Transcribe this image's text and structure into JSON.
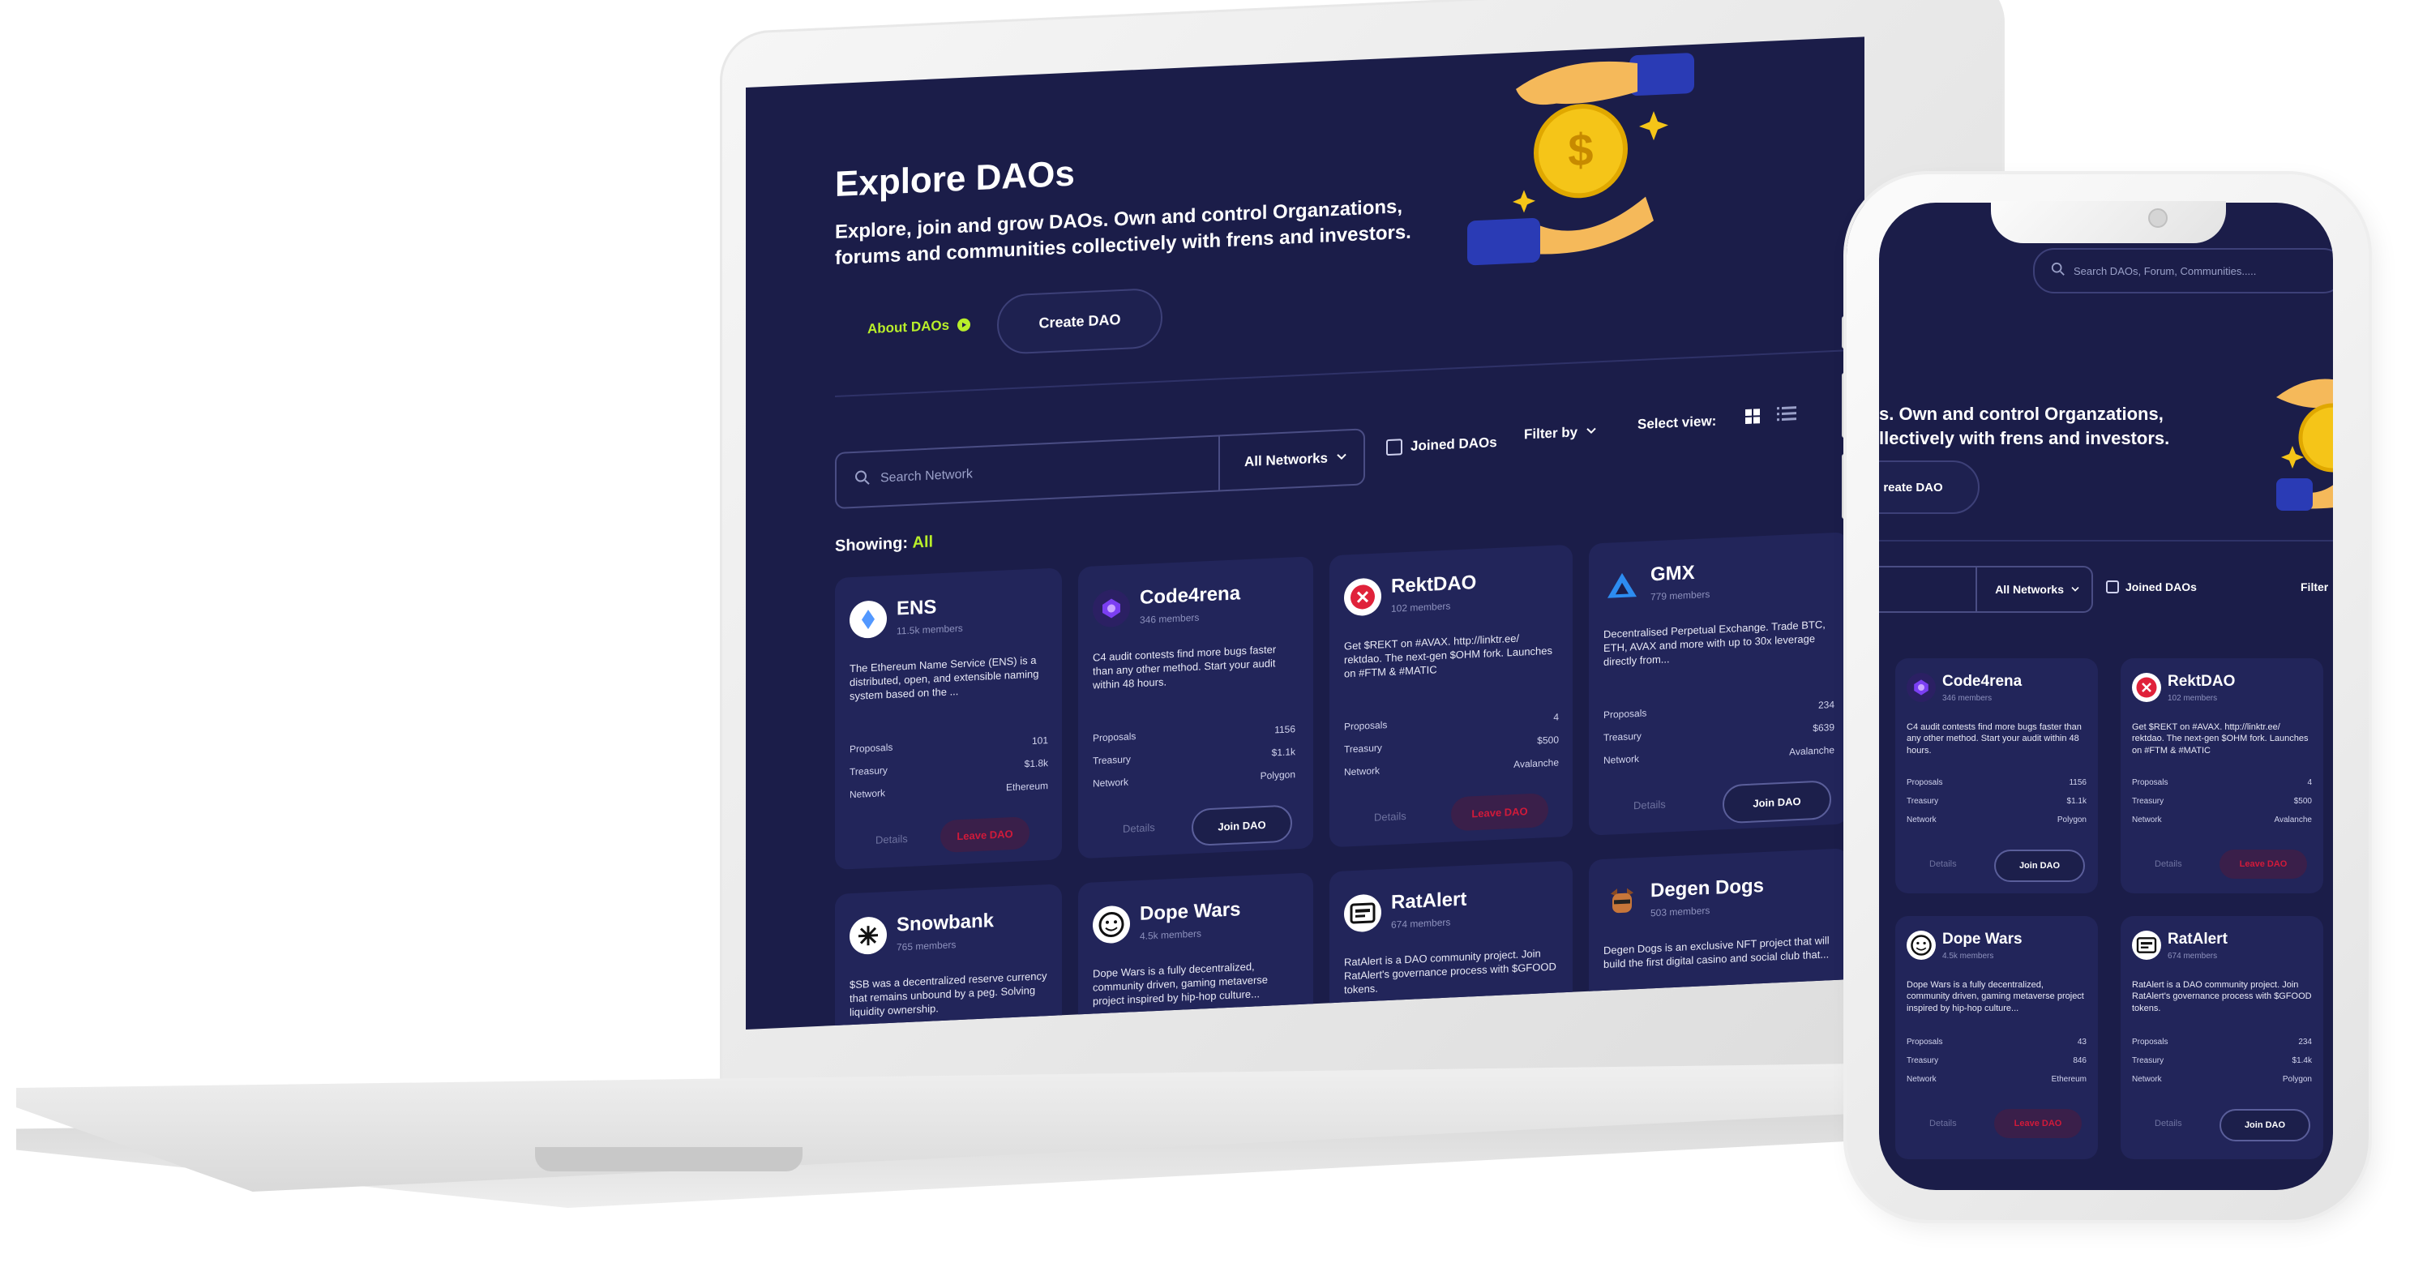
{
  "header": {
    "title": "Explore DAOs",
    "subtitle_line1": "Explore, join and grow DAOs. Own and control Organzations,",
    "subtitle_line2": "forums and communities collectively with frens and investors.",
    "about_label": "About DAOs",
    "create_label": "Create DAO",
    "phone_subtitle_line1": "s. Own and control Organzations,",
    "phone_subtitle_line2": "llectively with frens and investors.",
    "phone_create_label": "reate DAO"
  },
  "toolbar": {
    "search_placeholder": "Search Network",
    "network_select": "All Networks",
    "joined_label": "Joined DAOs",
    "filter_label": "Filter by",
    "select_view_label": "Select view:",
    "showing_label": "Showing:",
    "showing_value": "All",
    "phone_search_placeholder": "Search DAOs, Forum, Communities.....",
    "phone_filter_label": "Filter"
  },
  "cards": [
    {
      "name": "ENS",
      "members": "11.5k members",
      "desc": "The Ethereum Name Service (ENS) is a distributed, open, and extensible naming system based on the ...",
      "proposals": "101",
      "treasury": "$1.8k",
      "network": "Ethereum",
      "action": "Leave DAO",
      "details": "Details"
    },
    {
      "name": "Code4rena",
      "members": "346 members",
      "desc": "C4 audit contests find more bugs faster than any other method. Start your audit within 48 hours.",
      "proposals": "1156",
      "treasury": "$1.1k",
      "network": "Polygon",
      "action": "Join DAO",
      "details": "Details"
    },
    {
      "name": "RektDAO",
      "members": "102 members",
      "desc": "Get $REKT on #AVAX. http://linktr.ee/ rektdao. The next-gen $OHM fork. Launches on #FTM  & #MATIC",
      "proposals": "4",
      "treasury": "$500",
      "network": "Avalanche",
      "action": "Leave DAO",
      "details": "Details"
    },
    {
      "name": "GMX",
      "members": "779 members",
      "desc": "Decentralised Perpetual Exchange. Trade BTC, ETH, AVAX and more with up to 30x leverage directly from...",
      "proposals": "234",
      "treasury": "$639",
      "network": "Avalanche",
      "action": "Join DAO",
      "details": "Details"
    },
    {
      "name": "Snowbank",
      "members": "765 members",
      "desc": "$SB was a decentralized reserve currency that remains unbound by a peg. Solving liquidity ownership."
    },
    {
      "name": "Dope Wars",
      "members": "4.5k members",
      "desc": "Dope Wars is a fully decentralized, community driven, gaming metaverse project inspired by hip-hop culture..."
    },
    {
      "name": "RatAlert",
      "members": "674 members",
      "desc": "RatAlert is a DAO community project. Join RatAlert's governance process with $GFOOD tokens."
    },
    {
      "name": "Degen Dogs",
      "members": "503 members",
      "desc": "Degen Dogs is an exclusive NFT project that will build the first digital casino and social club that..."
    }
  ],
  "phone_cards": [
    {
      "name": "Code4rena",
      "members": "346 members",
      "desc": "C4 audit contests find more bugs faster than any other method. Start your audit within 48 hours.",
      "proposals": "1156",
      "treasury": "$1.1k",
      "network": "Polygon",
      "action": "Join DAO",
      "details": "Details"
    },
    {
      "name": "RektDAO",
      "members": "102 members",
      "desc": "Get $REKT on #AVAX. http://linktr.ee/ rektdao. The next-gen $OHM fork. Launches on #FTM  & #MATIC",
      "proposals": "4",
      "treasury": "$500",
      "network": "Avalanche",
      "action": "Leave DAO",
      "details": "Details"
    },
    {
      "name": "Dope Wars",
      "members": "4.5k members",
      "desc": "Dope Wars is a fully decentralized, community driven, gaming metaverse project inspired by hip-hop culture...",
      "proposals": "43",
      "treasury": "846",
      "network": "Ethereum",
      "action": "Leave DAO",
      "details": "Details"
    },
    {
      "name": "RatAlert",
      "members": "674 members",
      "desc": "RatAlert is a DAO community project. Join RatAlert's governance process with $GFOOD tokens.",
      "proposals": "234",
      "treasury": "$1.4k",
      "network": "Polygon",
      "action": "Join DAO",
      "details": "Details"
    }
  ],
  "labels": {
    "proposals": "Proposals",
    "treasury": "Treasury",
    "network": "Network"
  },
  "colors": {
    "background": "#1b1d49",
    "card": "#22255a",
    "accent": "#b9ef2a",
    "leave": "#d11a3a",
    "gold": "#f5c518"
  },
  "icons": [
    "search-icon",
    "chevron-down-icon",
    "grid-view-icon",
    "list-view-icon",
    "play-icon",
    "checkbox-icon",
    "coin-hand-illustration"
  ]
}
